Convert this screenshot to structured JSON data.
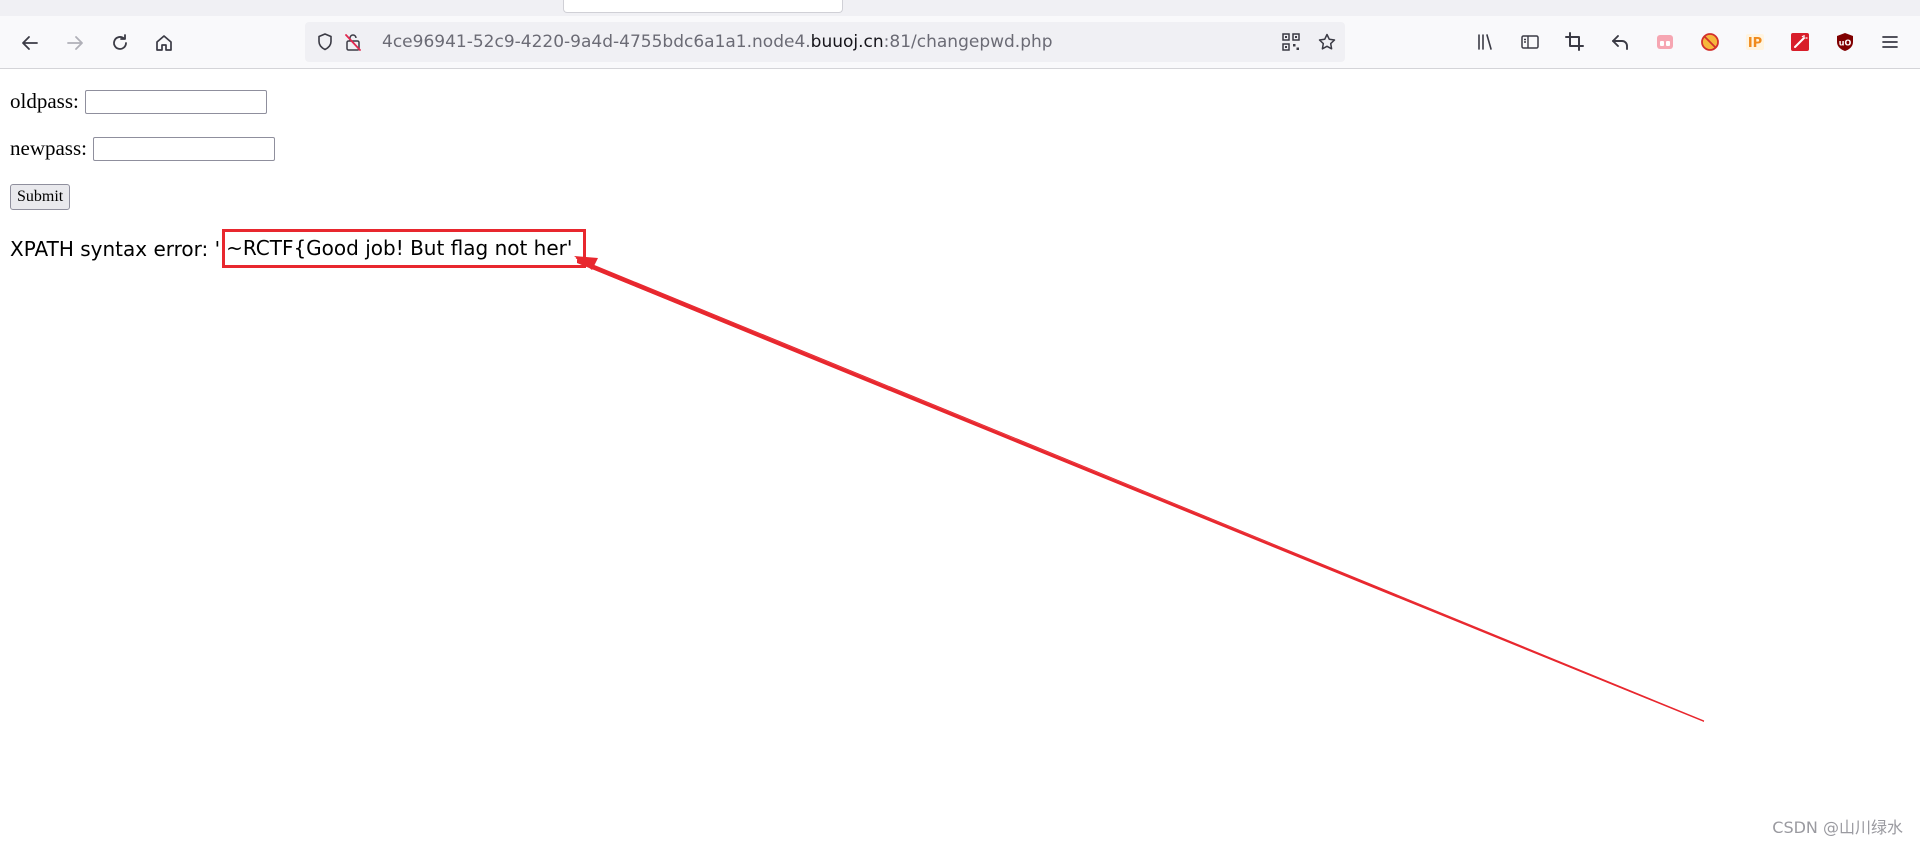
{
  "browser": {
    "url_prefix": "4ce96941-52c9-4220-9a4d-4755bdc6a1a1.node4.",
    "url_domain": "buuoj.cn",
    "url_suffix": ":81/changepwd.php",
    "icons": {
      "back": "back-arrow-icon",
      "forward": "forward-arrow-icon",
      "reload": "reload-icon",
      "home": "home-icon",
      "tracking_protection": "shield-icon",
      "insecure_lock": "insecure-lock-icon",
      "qr_code": "qr-code-icon",
      "bookmark_star": "star-icon",
      "library": "library-icon",
      "sidebar": "sidebar-icon",
      "screenshot": "crop-icon",
      "undo": "undo-arrow-icon",
      "extension_pink": "extension-pink-icon",
      "extension_blocked": "blocked-orange-icon",
      "extension_ip": "ip-badge-icon",
      "extension_wand": "wand-red-icon",
      "ublock": "ublock-origin-icon",
      "menu": "hamburger-menu-icon"
    }
  },
  "page": {
    "oldpass_label": "oldpass:",
    "oldpass_value": "",
    "newpass_label": "newpass:",
    "newpass_value": "",
    "submit_label": "Submit",
    "error_prefix": "XPATH syntax error: '",
    "error_highlight": "~RCTF{Good job! But flag not her'"
  },
  "annotation": {
    "box_color": "#e8272e",
    "arrow_color": "#e8272e"
  },
  "watermark": "CSDN @山川绿水"
}
